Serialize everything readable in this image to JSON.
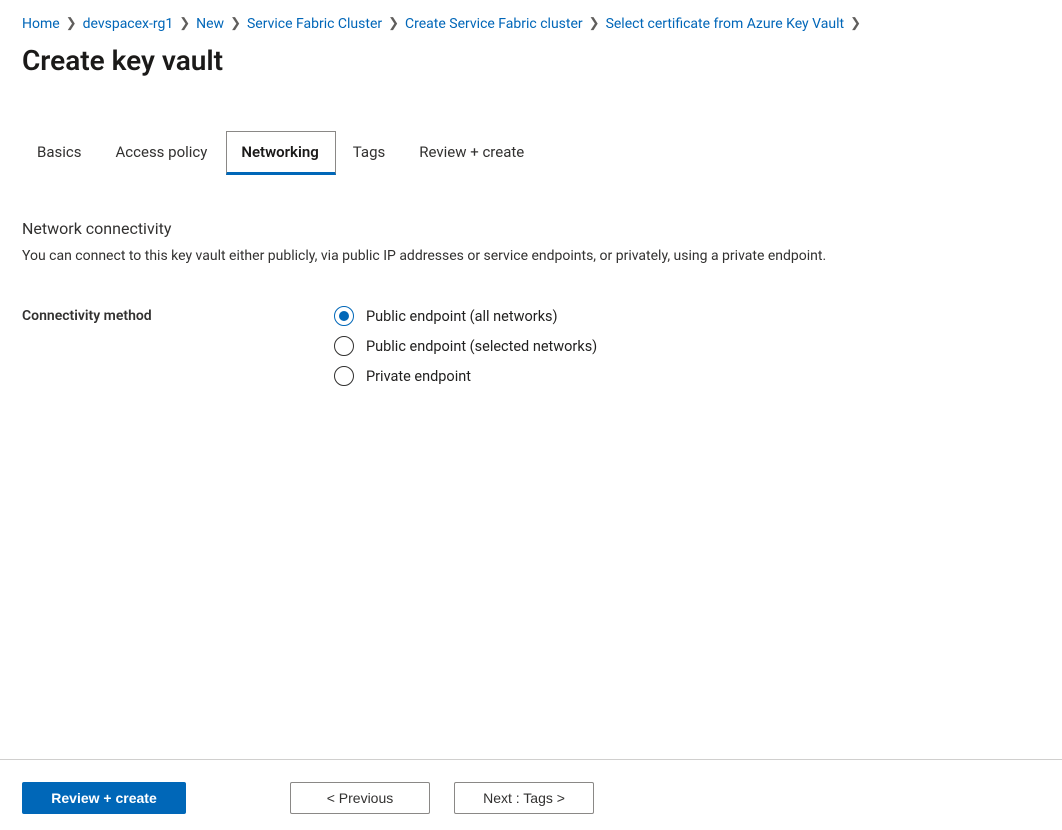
{
  "breadcrumb": [
    "Home",
    "devspacex-rg1",
    "New",
    "Service Fabric Cluster",
    "Create Service Fabric cluster",
    "Select certificate from Azure Key Vault"
  ],
  "page_title": "Create key vault",
  "tabs": {
    "items": [
      {
        "label": "Basics",
        "active": false
      },
      {
        "label": "Access policy",
        "active": false
      },
      {
        "label": "Networking",
        "active": true
      },
      {
        "label": "Tags",
        "active": false
      },
      {
        "label": "Review + create",
        "active": false
      }
    ]
  },
  "section": {
    "heading": "Network connectivity",
    "description": "You can connect to this key vault either publicly, via public IP addresses or service endpoints, or privately, using a private endpoint."
  },
  "field": {
    "label": "Connectivity method",
    "options": [
      {
        "label": "Public endpoint (all networks)",
        "selected": true
      },
      {
        "label": "Public endpoint (selected networks)",
        "selected": false
      },
      {
        "label": "Private endpoint",
        "selected": false
      }
    ]
  },
  "footer": {
    "review_create": "Review + create",
    "previous": "<  Previous",
    "next": "Next : Tags  >"
  }
}
